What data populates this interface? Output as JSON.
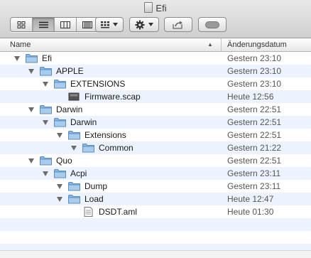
{
  "window": {
    "title": "Efi",
    "title_icon": "volume-drive-icon"
  },
  "toolbar": {
    "view_buttons": [
      "icon-view-icon",
      "list-view-icon",
      "column-view-icon",
      "cover-flow-icon"
    ],
    "active_view": "list",
    "arrange_button": "arrange-grid-icon",
    "action_button": "gear-icon",
    "share_button": "share-icon",
    "tags_button": "tag-icon"
  },
  "columns": {
    "name": "Name",
    "date": "Änderungsdatum",
    "sort_indicator": "▲"
  },
  "files": [
    {
      "name": "Efi",
      "date": "Gestern 23:10",
      "kind": "folder",
      "depth": 0,
      "expanded": true
    },
    {
      "name": "APPLE",
      "date": "Gestern 23:10",
      "kind": "folder",
      "depth": 1,
      "expanded": true
    },
    {
      "name": "EXTENSIONS",
      "date": "Gestern 23:10",
      "kind": "folder",
      "depth": 2,
      "expanded": true
    },
    {
      "name": "Firmware.scap",
      "date": "Heute 12:56",
      "kind": "scap-file",
      "depth": 3,
      "expanded": false
    },
    {
      "name": "Darwin",
      "date": "Gestern 22:51",
      "kind": "folder",
      "depth": 1,
      "expanded": true
    },
    {
      "name": "Darwin",
      "date": "Gestern 22:51",
      "kind": "folder",
      "depth": 2,
      "expanded": true
    },
    {
      "name": "Extensions",
      "date": "Gestern 22:51",
      "kind": "folder",
      "depth": 3,
      "expanded": true
    },
    {
      "name": "Common",
      "date": "Gestern 21:22",
      "kind": "folder",
      "depth": 4,
      "expanded": true
    },
    {
      "name": "Quo",
      "date": "Gestern 22:51",
      "kind": "folder",
      "depth": 1,
      "expanded": true
    },
    {
      "name": "Acpi",
      "date": "Gestern 23:11",
      "kind": "folder",
      "depth": 2,
      "expanded": true
    },
    {
      "name": "Dump",
      "date": "Gestern 23:11",
      "kind": "folder",
      "depth": 3,
      "expanded": true
    },
    {
      "name": "Load",
      "date": "Heute 12:47",
      "kind": "folder",
      "depth": 3,
      "expanded": true
    },
    {
      "name": "DSDT.aml",
      "date": "Heute 01:30",
      "kind": "document-file",
      "depth": 4,
      "expanded": false
    }
  ],
  "colors": {
    "folder": "#8ab6e0",
    "folder_dark": "#5b8fc4",
    "row_alt": "#edf3fe"
  }
}
